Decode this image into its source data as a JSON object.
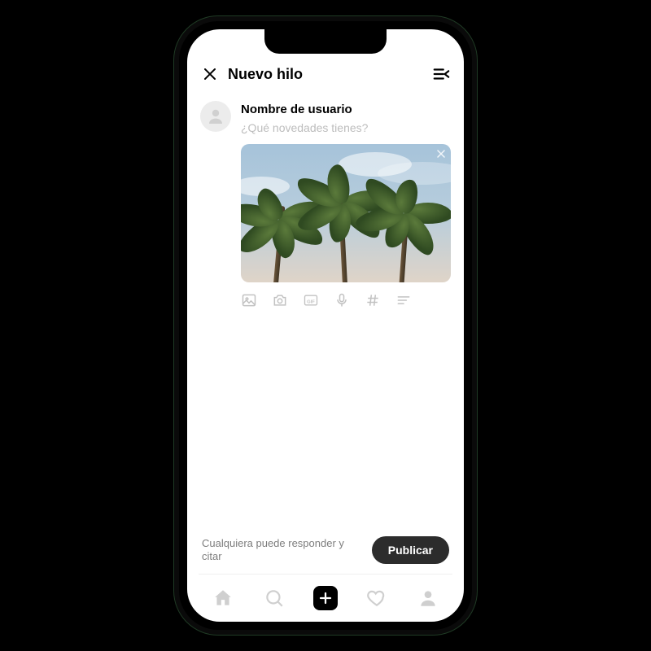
{
  "header": {
    "title": "Nuevo hilo"
  },
  "composer": {
    "username": "Nombre de usuario",
    "placeholder": "¿Qué novedades tienes?"
  },
  "attachment": {
    "description": "palm-trees-photo"
  },
  "tools": {
    "gallery": "gallery-icon",
    "camera": "camera-icon",
    "gif": "gif-icon",
    "mic": "mic-icon",
    "hash": "hash-icon",
    "more": "align-icon"
  },
  "footer": {
    "reply_hint": "Cualquiera puede responder y citar",
    "publish_label": "Publicar"
  },
  "nav": {
    "home": "home-icon",
    "search": "search-icon",
    "compose": "compose-icon",
    "activity": "heart-icon",
    "profile": "profile-icon"
  }
}
